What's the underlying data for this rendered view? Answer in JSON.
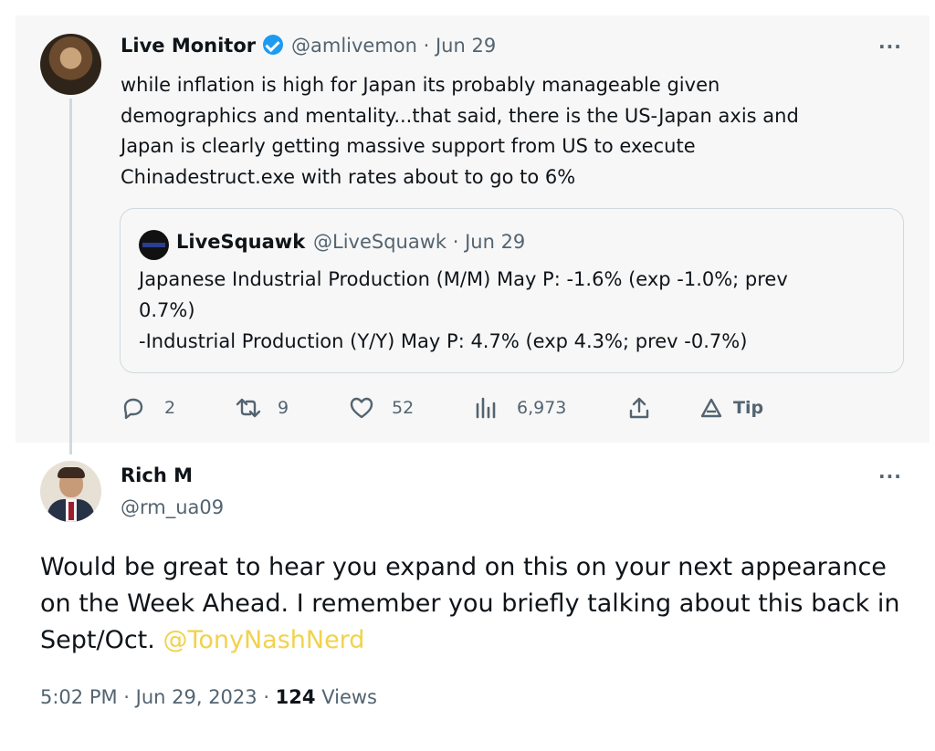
{
  "tweet1": {
    "author_name": "Live Monitor",
    "handle_date": "@amlivemon · Jun 29",
    "lines": [
      "while inflation is high for Japan its probably manageable given",
      "demographics and mentality...that said, there is the US-Japan axis and",
      "Japan is clearly getting massive support from US to execute",
      "Chinadestruct.exe with rates about to go to 6%"
    ],
    "more": "···",
    "quote": {
      "author_name": "LiveSquawk",
      "handle_date": "@LiveSquawk · Jun 29",
      "lines": [
        "Japanese Industrial Production (M/M) May P: -1.6% (exp -1.0%; prev",
        "0.7%)",
        "-Industrial Production (Y/Y) May P: 4.7% (exp 4.3%; prev -0.7%)"
      ]
    },
    "actions": {
      "reply_count": "2",
      "retweet_count": "9",
      "like_count": "52",
      "views_count": "6,973",
      "tip_label": "Tip"
    }
  },
  "tweet2": {
    "author_name": "Rich M",
    "handle": "@rm_ua09",
    "more": "···",
    "body_text": "Would be great to hear you expand on this on your next appearance on the Week Ahead. I remember you briefly talking about this back in Sept/Oct.",
    "mention": "@TonyNashNerd",
    "time_date": "5:02 PM · Jun 29, 2023 · ",
    "views_count": "124",
    "views_label": "Views"
  },
  "colors": {
    "verified": "#1d9bf0",
    "mention": "#f2d24b",
    "secondary_text": "#536471"
  }
}
